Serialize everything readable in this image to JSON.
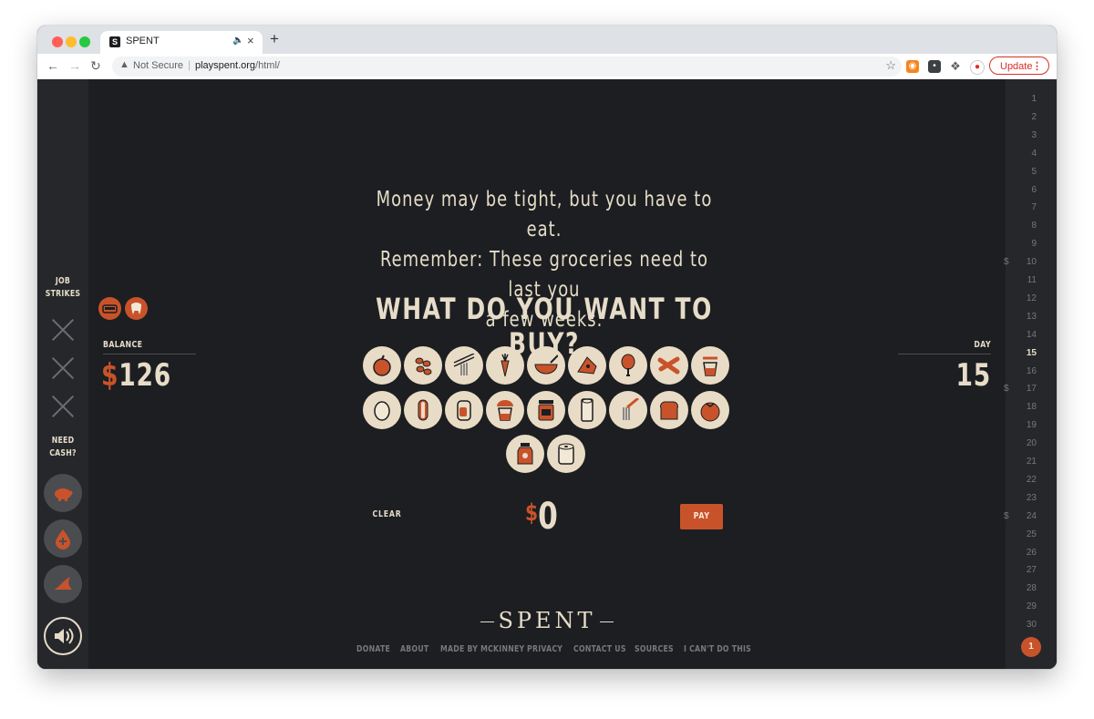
{
  "browser": {
    "tab_title": "SPENT",
    "new_tab_label": "+",
    "security_label": "Not Secure",
    "url_host": "playspent.org",
    "url_path": "/html/",
    "update_label": "Update"
  },
  "sidebar": {
    "job_strikes_label": [
      "JOB",
      "STRIKES"
    ],
    "strike_count": 3,
    "need_cash_label": [
      "NEED",
      "CASH?"
    ],
    "cash_options": [
      "piggy-bank-icon",
      "blood-drop-icon",
      "shark-fin-icon"
    ],
    "sound_icon": "speaker-icon"
  },
  "status_icons": [
    "car-icon",
    "tooth-icon"
  ],
  "balance": {
    "label": "BALANCE",
    "currency": "$",
    "amount": "126"
  },
  "day": {
    "label": "DAY",
    "value": "15"
  },
  "main": {
    "message_lines": [
      "Money may be tight, but you have to eat.",
      "Remember: These groceries need to last you",
      "a few weeks."
    ],
    "question": "WHAT DO YOU WANT TO BUY?",
    "grocery_items": [
      "apple-icon",
      "beans-icon",
      "noodles-icon",
      "carrot-icon",
      "cereal-bowl-icon",
      "cheese-icon",
      "drumstick-icon",
      "sausage-icon",
      "juice-cup-icon",
      "egg-icon",
      "hot-dog-icon",
      "soda-can-icon",
      "ice-cream-cup-icon",
      "jam-jar-icon",
      "paper-towel-icon",
      "spaghetti-icon",
      "bread-icon",
      "tomato-icon",
      "sauce-jar-icon",
      "toilet-paper-icon"
    ],
    "clear_label": "CLEAR",
    "total_currency": "$",
    "total_amount": "0",
    "pay_label": "PAY"
  },
  "footer": {
    "logo": "SPENT",
    "links": [
      "DONATE",
      "ABOUT",
      "MADE BY MCKINNEY",
      "PRIVACY",
      "CONTACT US",
      "SOURCES",
      "I CAN'T DO THIS"
    ]
  },
  "calendar": {
    "days": [
      "1",
      "2",
      "3",
      "4",
      "5",
      "6",
      "7",
      "8",
      "9",
      "10",
      "11",
      "12",
      "13",
      "14",
      "15",
      "16",
      "17",
      "18",
      "19",
      "20",
      "21",
      "22",
      "23",
      "24",
      "25",
      "26",
      "27",
      "28",
      "29",
      "30"
    ],
    "payday_days": [
      "10",
      "17",
      "24"
    ],
    "pay_marker": "$",
    "current_day": "15",
    "badge_value": "1"
  },
  "colors": {
    "background": "#1c1e21",
    "sidebar": "#25272b",
    "cream": "#e6dcc8",
    "accent": "#c8532b",
    "muted": "#75787c"
  }
}
